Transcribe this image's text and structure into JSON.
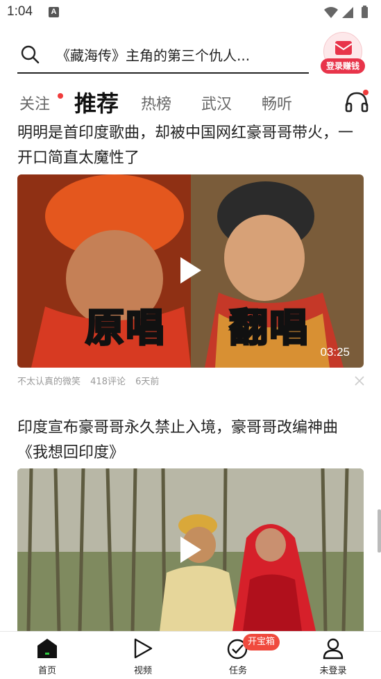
{
  "status_bar": {
    "time": "1:04",
    "notif_letter": "A"
  },
  "search": {
    "placeholder_text": "《藏海传》主角的第三个仇人..."
  },
  "login_badge": {
    "label": "登录赚钱"
  },
  "tabs": [
    {
      "label": "关注",
      "has_dot": true
    },
    {
      "label": "推荐",
      "active": true
    },
    {
      "label": "热榜"
    },
    {
      "label": "武汉"
    },
    {
      "label": "畅听"
    }
  ],
  "articles": [
    {
      "title": "明明是首印度歌曲，却被中国网红豪哥哥带火，一开口简直太魔性了",
      "thumb_left_caption": "原唱",
      "thumb_right_caption": "翻唱",
      "duration": "03:25",
      "author": "不太认真的微笑",
      "comments": "418评论",
      "time": "6天前"
    },
    {
      "title": "印度宣布豪哥哥永久禁止入境，豪哥哥改编神曲《我想回印度》"
    }
  ],
  "bottom_nav": [
    {
      "label": "首页",
      "icon": "home-icon"
    },
    {
      "label": "视频",
      "icon": "play-icon"
    },
    {
      "label": "任务",
      "icon": "check-icon"
    },
    {
      "label": "未登录",
      "icon": "user-icon"
    }
  ],
  "task_badge": "开宝箱",
  "colors": {
    "accent_red": "#e8344a",
    "badge_red": "#f04a3e",
    "nav_home_green": "#2ecc40"
  }
}
